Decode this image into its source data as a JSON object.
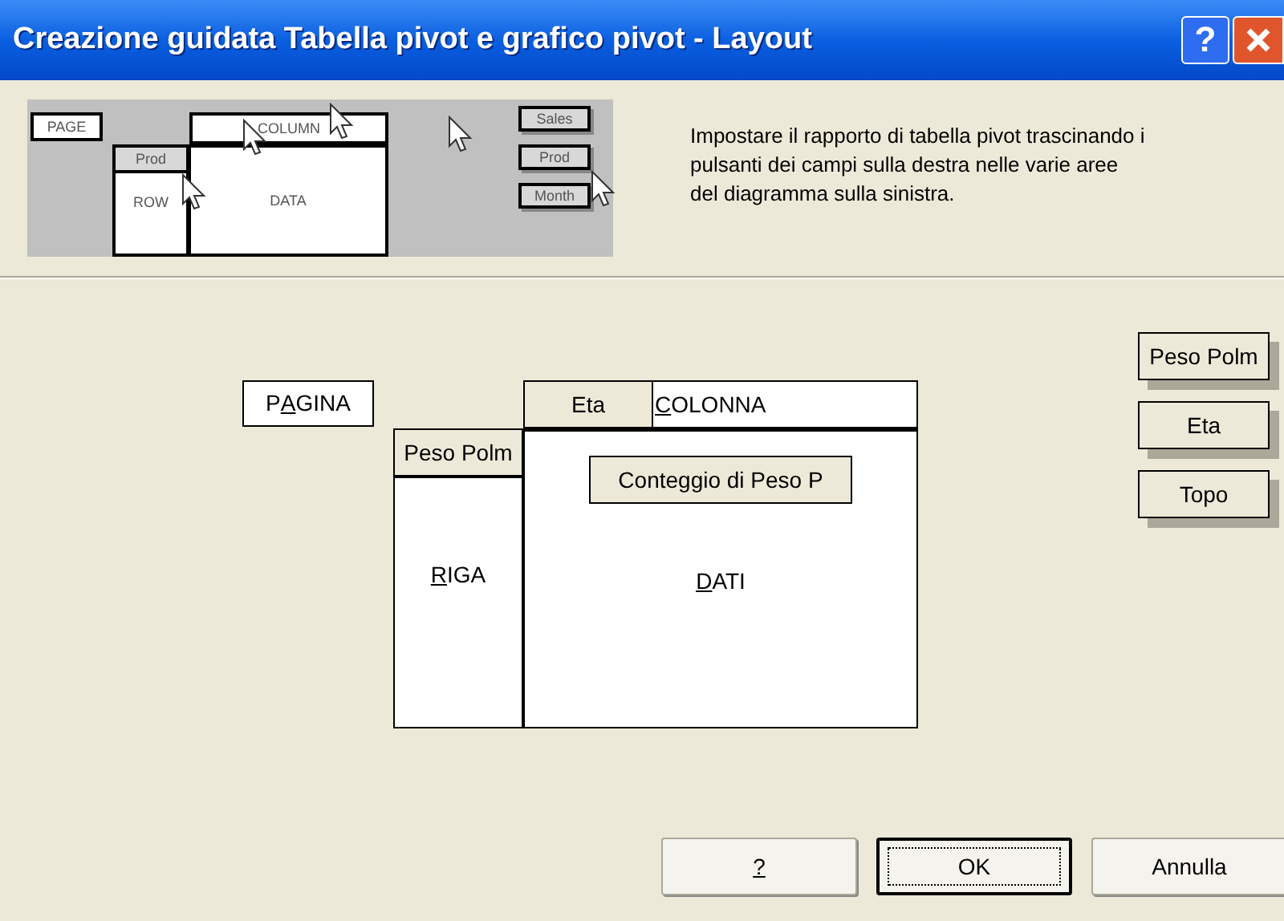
{
  "window": {
    "title": "Creazione guidata Tabella pivot e grafico pivot - Layout",
    "help_glyph": "?"
  },
  "illustration": {
    "page": "PAGE",
    "column": "COLUMN",
    "row_field": "Prod",
    "row": "ROW",
    "data": "DATA",
    "fields": [
      "Sales",
      "Prod",
      "Month"
    ]
  },
  "instructions": "Impostare il rapporto di tabella pivot trascinando i pulsanti dei campi sulla destra nelle varie aree del diagramma sulla sinistra.",
  "page_area": {
    "label": {
      "before": "P",
      "key": "A",
      "after": "GINA"
    }
  },
  "column_area": {
    "label": {
      "key": "C",
      "after": "OLONNA"
    },
    "fields": [
      "Eta"
    ]
  },
  "row_area": {
    "label": {
      "key": "R",
      "after": "IGA"
    },
    "fields": [
      "Peso Polm"
    ]
  },
  "data_area": {
    "label": {
      "key": "D",
      "after": "ATI"
    },
    "fields": [
      "Conteggio di Peso P"
    ]
  },
  "field_buttons": [
    "Peso Polm",
    "Eta",
    "Topo"
  ],
  "buttons": [
    {
      "label": {
        "key": "?"
      },
      "default": false
    },
    {
      "label": {
        "before": "OK"
      },
      "default": true
    },
    {
      "label": {
        "before": "Annulla"
      },
      "default": false
    }
  ]
}
